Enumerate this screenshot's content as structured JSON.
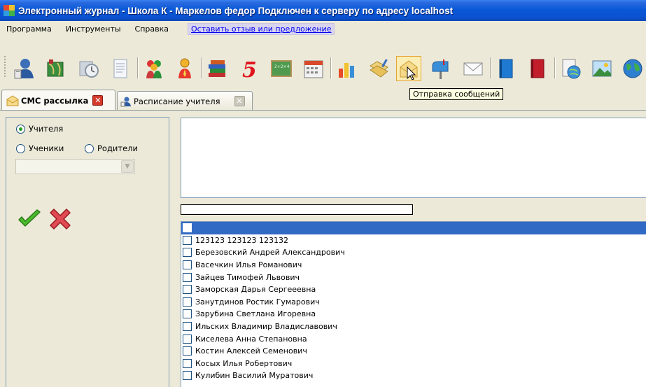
{
  "window": {
    "title": "Электронный журнал - Школа К - Маркелов федор Подключен к серверу по адресу localhost"
  },
  "menu": {
    "items": [
      "Программа",
      "Инструменты",
      "Справка"
    ],
    "feedback_link": "Оставить отзыв или предложение"
  },
  "toolbar": {
    "buttons": [
      "user-icon",
      "map-icon",
      "clock-icon",
      "document-icon",
      "group-icon",
      "person-icon",
      "books-icon",
      "grade-five-icon",
      "chalkboard-icon",
      "calendar-icon",
      "chart-icon",
      "folders-icon",
      "envelope-open-icon",
      "mailbox-icon",
      "envelope-icon",
      "blue-book-icon",
      "red-book-icon",
      "globe-doc-icon",
      "picture-icon",
      "earth-icon"
    ],
    "active_button": "envelope-open-icon",
    "tooltip": "Отправка сообщений"
  },
  "tabs": [
    {
      "label": "СМС рассылка",
      "icon": "envelope-icon",
      "active": true
    },
    {
      "label": "Расписание учителя",
      "icon": "person-icon",
      "active": false
    }
  ],
  "recipients": {
    "options": [
      "Учителя",
      "Ученики",
      "Родители"
    ],
    "selected": "Учителя",
    "combo_value": ""
  },
  "actions": {
    "confirm": "check-icon",
    "cancel": "cross-icon"
  },
  "message": {
    "text": "",
    "progress": 0
  },
  "people": [
    {
      "name": "",
      "checked": false,
      "selected": true
    },
    {
      "name": "123123 123123 123132",
      "checked": false
    },
    {
      "name": "Березовский Андрей Александрович",
      "checked": false
    },
    {
      "name": "Васечкин Илья Романович",
      "checked": false
    },
    {
      "name": "Зайцев Тимофей Львович",
      "checked": false
    },
    {
      "name": "Заморская Дарья Сергееевна",
      "checked": false
    },
    {
      "name": "Занутдинов Ростик Гумарович",
      "checked": false
    },
    {
      "name": "Зарубина Светлана Игоревна",
      "checked": false
    },
    {
      "name": "Ильских Владимир Владиславович",
      "checked": false
    },
    {
      "name": "Киселева Анна Степановна",
      "checked": false
    },
    {
      "name": "Костин Алексей Семенович",
      "checked": false
    },
    {
      "name": "Косых Илья Робертович",
      "checked": false
    },
    {
      "name": "Кулибин Василий Муратович",
      "checked": false
    }
  ]
}
